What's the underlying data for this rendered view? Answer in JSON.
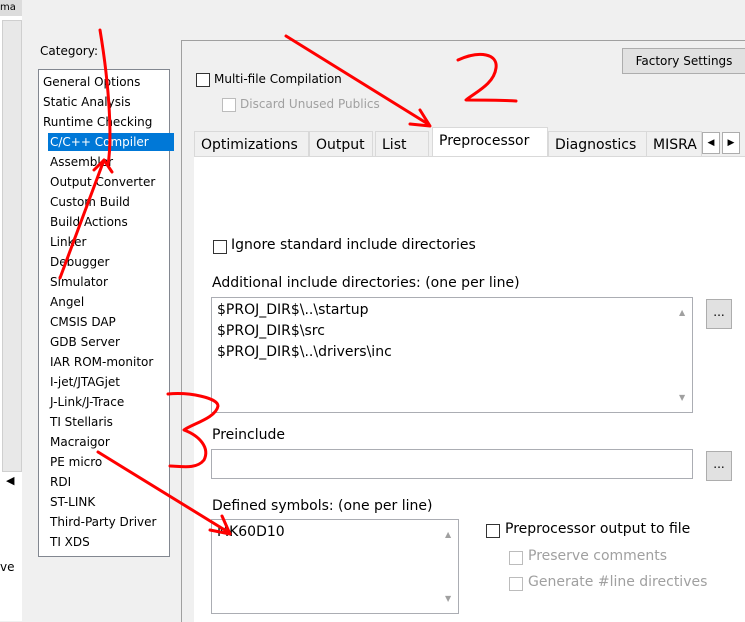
{
  "background_window": {
    "title_fragment": "ma",
    "bottom_fragment": "ve"
  },
  "category": {
    "label": "Category:",
    "items": [
      {
        "label": "General Options",
        "indent": false
      },
      {
        "label": "Static Analysis",
        "indent": false
      },
      {
        "label": "Runtime Checking",
        "indent": false
      },
      {
        "label": "C/C++ Compiler",
        "indent": true,
        "selected": true
      },
      {
        "label": "Assembler",
        "indent": true
      },
      {
        "label": "Output Converter",
        "indent": true
      },
      {
        "label": "Custom Build",
        "indent": true
      },
      {
        "label": "Build Actions",
        "indent": true
      },
      {
        "label": "Linker",
        "indent": true
      },
      {
        "label": "Debugger",
        "indent": true
      },
      {
        "label": "Simulator",
        "indent": true
      },
      {
        "label": "Angel",
        "indent": true
      },
      {
        "label": "CMSIS DAP",
        "indent": true
      },
      {
        "label": "GDB Server",
        "indent": true
      },
      {
        "label": "IAR ROM-monitor",
        "indent": true
      },
      {
        "label": "I-jet/JTAGjet",
        "indent": true
      },
      {
        "label": "J-Link/J-Trace",
        "indent": true
      },
      {
        "label": "TI Stellaris",
        "indent": true
      },
      {
        "label": "Macraigor",
        "indent": true
      },
      {
        "label": "PE micro",
        "indent": true
      },
      {
        "label": "RDI",
        "indent": true
      },
      {
        "label": "ST-LINK",
        "indent": true
      },
      {
        "label": "Third-Party Driver",
        "indent": true
      },
      {
        "label": "TI XDS",
        "indent": true
      }
    ]
  },
  "factory_settings_label": "Factory Settings",
  "multi_file": {
    "label": "Multi-file Compilation",
    "checked": false
  },
  "discard_unused": {
    "label": "Discard Unused Publics",
    "checked": false,
    "disabled": true
  },
  "tabs": [
    "Optimizations",
    "Output",
    "List",
    "Preprocessor",
    "Diagnostics",
    "MISRA"
  ],
  "active_tab": "Preprocessor",
  "preprocessor": {
    "ignore_std": {
      "label": "Ignore standard include directories",
      "checked": false
    },
    "include_dirs_label": "Additional include directories: (one per line)",
    "include_dirs": [
      "$PROJ_DIR$\\..\\startup",
      "$PROJ_DIR$\\src",
      "$PROJ_DIR$\\..\\drivers\\inc"
    ],
    "preinclude_label": "Preinclude",
    "preinclude_value": "",
    "defined_symbols_label": "Defined symbols: (one per line)",
    "defined_symbols": [
      "MK60D10"
    ],
    "output_to_file": {
      "label": "Preprocessor output to file",
      "checked": false
    },
    "preserve_comments": {
      "label": "Preserve comments",
      "checked": false,
      "disabled": true
    },
    "generate_line": {
      "label": "Generate #line directives",
      "checked": false,
      "disabled": true
    },
    "browse_label": "..."
  },
  "colors": {
    "selection": "#0078d7",
    "annotation": "#ff0000"
  }
}
